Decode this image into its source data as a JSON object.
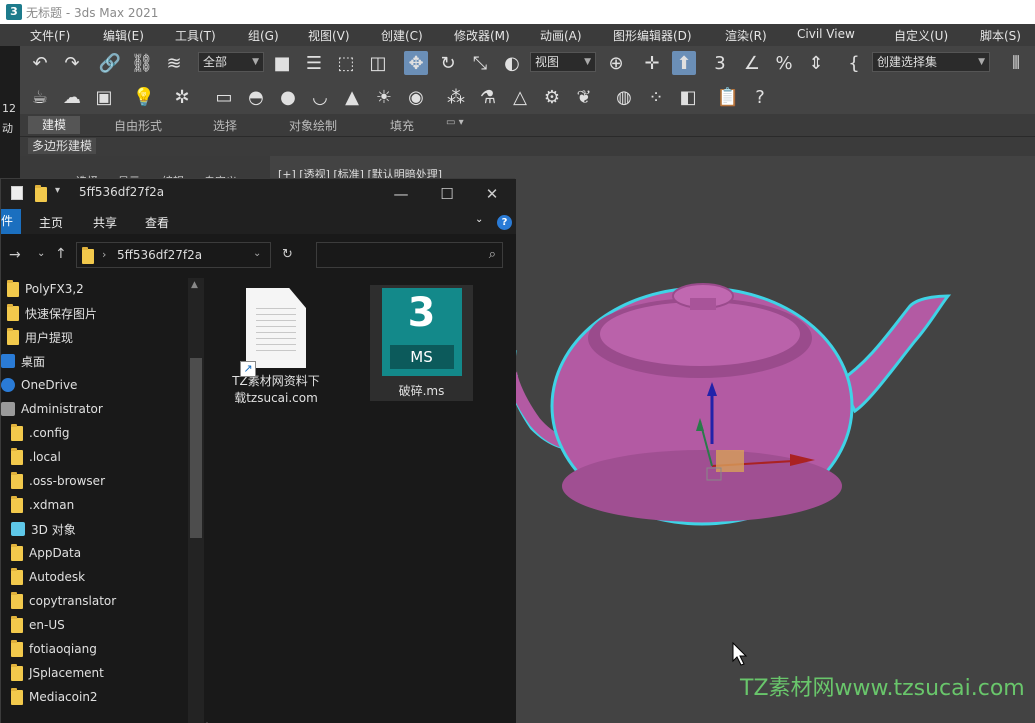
{
  "window": {
    "title": "无标题 - 3ds Max 2021"
  },
  "menubar": [
    "文件(F)",
    "编辑(E)",
    "工具(T)",
    "组(G)",
    "视图(V)",
    "创建(C)",
    "修改器(M)",
    "动画(A)",
    "图形编辑器(D)",
    "渲染(R)",
    "Civil View",
    "自定义(U)",
    "脚本(S)"
  ],
  "toolbar": {
    "selection_filter": "全部",
    "reference_coord": "视图",
    "named_selection": "创建选择集"
  },
  "ribbon": {
    "tabs": [
      "建模",
      "自由形式",
      "选择",
      "对象绘制",
      "填充"
    ],
    "panel_label": "多边形建模"
  },
  "left_strip": [
    "12",
    "动"
  ],
  "command_panel_tabs": [
    "选择",
    "显示",
    "编辑",
    "自定义"
  ],
  "viewport": {
    "label": "[+] [透视] [标准] [默认明暗处理]"
  },
  "explorer": {
    "title": "5ff536df27f2a",
    "ribbon_tabs": [
      "件",
      "主页",
      "共享",
      "查看"
    ],
    "address_path": "5ff536df27f2a",
    "search_placeholder": "",
    "nav_items": [
      {
        "label": "PolyFX3,2",
        "icon": "folder-icon"
      },
      {
        "label": "快速保存图片",
        "icon": "folder-icon"
      },
      {
        "label": "用户提现",
        "icon": "folder-icon"
      },
      {
        "label": "桌面",
        "icon": "desktop-icon"
      },
      {
        "label": "OneDrive",
        "icon": "cloud-icon"
      },
      {
        "label": "Administrator",
        "icon": "user-icon"
      },
      {
        "label": ".config",
        "icon": "folder-icon"
      },
      {
        "label": ".local",
        "icon": "folder-icon"
      },
      {
        "label": ".oss-browser",
        "icon": "folder-icon"
      },
      {
        "label": ".xdman",
        "icon": "folder-icon"
      },
      {
        "label": "3D 对象",
        "icon": "3d-objects-icon"
      },
      {
        "label": "AppData",
        "icon": "folder-icon"
      },
      {
        "label": "Autodesk",
        "icon": "folder-icon"
      },
      {
        "label": "copytranslator",
        "icon": "folder-icon"
      },
      {
        "label": "en-US",
        "icon": "folder-icon"
      },
      {
        "label": "fotiaoqiang",
        "icon": "folder-icon"
      },
      {
        "label": "JSplacement",
        "icon": "folder-icon"
      },
      {
        "label": "Mediacoin2",
        "icon": "folder-icon"
      }
    ],
    "files": [
      {
        "name_line1": "TZ素材网资料下",
        "name_line2": "载tzsucai.com",
        "icon": "shortcut-document-icon"
      },
      {
        "name_line1": "破碎.ms",
        "name_line2": "",
        "icon": "maxscript-file-icon",
        "icon_text": "MS",
        "icon_glyph": "3"
      }
    ]
  },
  "watermark": "TZ素材网www.tzsucai.com",
  "colors": {
    "teapot": "#b35aa3",
    "outline": "#3fd3e6",
    "explorer_bg": "#191919",
    "accent": "#1b6fbf",
    "watermark": "#69c66b"
  }
}
